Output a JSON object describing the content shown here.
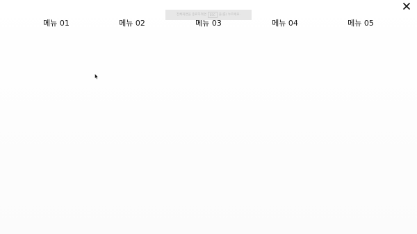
{
  "notice": {
    "text_before": "전체화면을 종료하려면",
    "key": "ESC",
    "text_after": "을(를) 누르세요."
  },
  "menu": {
    "items": [
      {
        "label": "메뉴 01"
      },
      {
        "label": "메뉴 02"
      },
      {
        "label": "메뉴 03"
      },
      {
        "label": "메뉴 04"
      },
      {
        "label": "메뉴 05"
      }
    ]
  },
  "icons": {
    "close": "close-icon",
    "cursor": "mouse-pointer-icon"
  }
}
